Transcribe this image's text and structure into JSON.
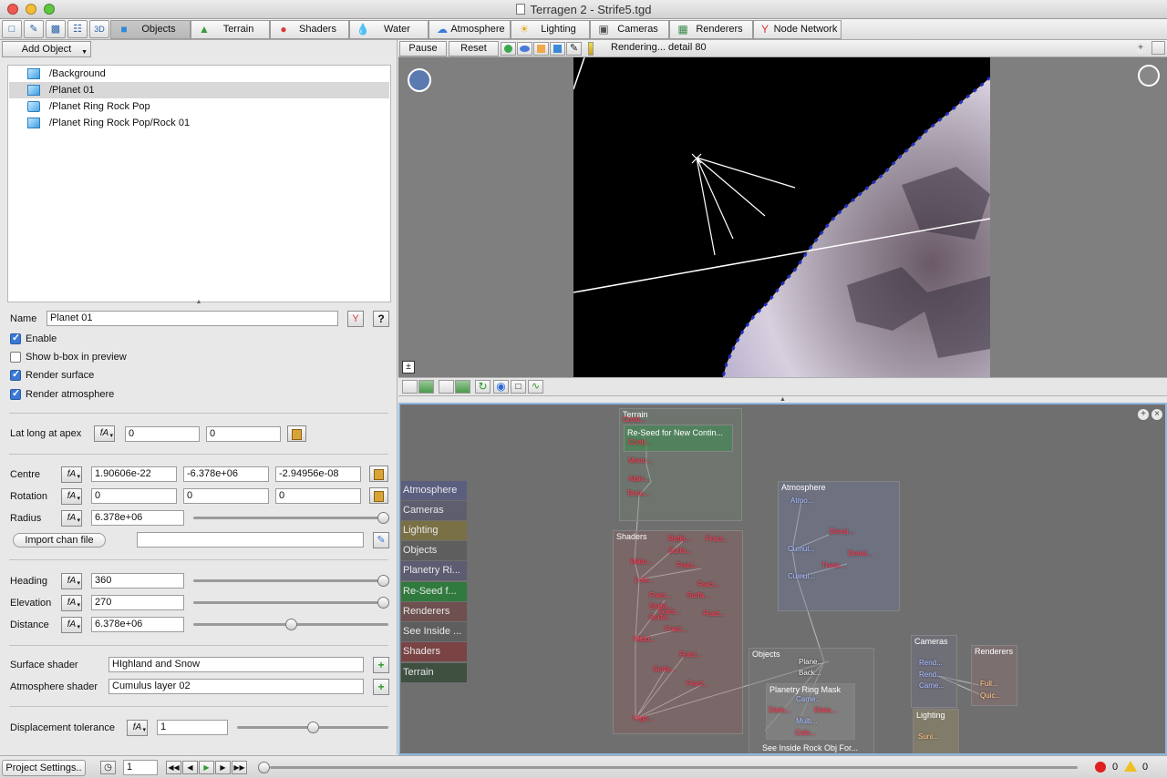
{
  "window": {
    "title": "Terragen 2 - Strife5.tgd"
  },
  "colors": {
    "selection": "#d8d8d8",
    "node_text_red": "#ff4060",
    "network_bg": "#6f6f6f",
    "active_tab": "#b8b8b8"
  },
  "toolbar": {
    "icons": [
      "new-file-icon",
      "open-file-icon",
      "save-file-icon",
      "render-settings-icon",
      "3d-preview-icon"
    ],
    "tabs": [
      {
        "label": "Objects",
        "icon": "cube-icon",
        "active": true
      },
      {
        "label": "Terrain",
        "icon": "terrain-icon"
      },
      {
        "label": "Shaders",
        "icon": "sphere-icon"
      },
      {
        "label": "Water",
        "icon": "water-drop-icon"
      },
      {
        "label": "Atmosphere",
        "icon": "sky-icon"
      },
      {
        "label": "Lighting",
        "icon": "sun-icon"
      },
      {
        "label": "Cameras",
        "icon": "camera-icon"
      },
      {
        "label": "Renderers",
        "icon": "render-icon"
      },
      {
        "label": "Node Network",
        "icon": "node-network-icon"
      }
    ]
  },
  "objects_panel": {
    "add_object_label": "Add Object",
    "items": [
      {
        "label": "/Background",
        "selected": false
      },
      {
        "label": "/Planet 01",
        "selected": true
      },
      {
        "label": "/Planet Ring Rock Pop",
        "selected": false
      },
      {
        "label": "/Planet Ring Rock Pop/Rock 01",
        "selected": false
      }
    ]
  },
  "properties": {
    "name_label": "Name",
    "name_value": "Planet 01",
    "help_label": "?",
    "checkboxes": [
      {
        "label": "Enable",
        "checked": true
      },
      {
        "label": "Show b-box in preview",
        "checked": false
      },
      {
        "label": "Render surface",
        "checked": true
      },
      {
        "label": "Render atmosphere",
        "checked": true
      }
    ],
    "latlong": {
      "label": "Lat long at apex",
      "values": [
        "0",
        "0"
      ]
    },
    "centre": {
      "label": "Centre",
      "values": [
        "1.90606e-22",
        "-6.378e+06",
        "-2.94956e-08"
      ]
    },
    "rotation": {
      "label": "Rotation",
      "values": [
        "0",
        "0",
        "0"
      ]
    },
    "radius": {
      "label": "Radius",
      "value": "6.378e+06",
      "slider_fraction": 1.0
    },
    "import_button": "Import chan file",
    "import_path": "",
    "heading": {
      "label": "Heading",
      "value": "360",
      "slider_fraction": 1.0
    },
    "elevation": {
      "label": "Elevation",
      "value": "270",
      "slider_fraction": 1.0
    },
    "distance": {
      "label": "Distance",
      "value": "6.378e+06",
      "slider_fraction": 0.5
    },
    "surface_shader": {
      "label": "Surface shader",
      "value": "HIghland and Snow"
    },
    "atmosphere_shader": {
      "label": "Atmosphere shader",
      "value": "Cumulus layer 02"
    },
    "displacement": {
      "label": "Displacement tolerance",
      "value": "1",
      "slider_fraction": 0.5
    },
    "fn_glyph": "fA"
  },
  "viewport": {
    "pause_label": "Pause",
    "reset_label": "Reset",
    "status": "Rendering... detail 80"
  },
  "network": {
    "side_tabs": [
      {
        "label": "Atmosphere",
        "color": "#5a5f80"
      },
      {
        "label": "Cameras",
        "color": "#5e5e6e"
      },
      {
        "label": "Lighting",
        "color": "#7a7046"
      },
      {
        "label": "Objects",
        "color": "#5e5e5e"
      },
      {
        "label": "Planetry Ri...",
        "color": "#5c5c72"
      },
      {
        "label": "Re-Seed f...",
        "color": "#2f7a3c"
      },
      {
        "label": "Renderers",
        "color": "#6e5050"
      },
      {
        "label": "See Inside ...",
        "color": "#5e5e5e"
      },
      {
        "label": "Shaders",
        "color": "#7a4444"
      },
      {
        "label": "Terrain",
        "color": "#3e5040"
      }
    ],
    "groups": {
      "terrain": "Terrain",
      "reseed": "Re-Seed for New Contin...",
      "shaders": "Shaders",
      "atmosphere": "Atmosphere",
      "objects": "Objects",
      "ring_mask": "Planetry Ring Mask",
      "see_inside": "See Inside Rock Obj For...",
      "cameras": "Cameras",
      "renderers": "Renderers",
      "lighting": "Lighting"
    },
    "nodes": {
      "terrain": [
        "Conti...",
        "Conti...",
        "Moun...",
        "Alpin...",
        "Textu..."
      ],
      "shaders": [
        "Refle...",
        "Fract...",
        "Surfa...",
        "Wate...",
        "Fract...",
        "Low...",
        "Fract...",
        "Fract...",
        "Surfa...",
        "Fract...",
        "Surfa...",
        "Fract...",
        "Surfa...",
        "Fract...",
        "Midd...",
        "Fract...",
        "Surfa...",
        "Fract...",
        "HIgh..."
      ],
      "atmosphere": [
        "Atmo...",
        "Densi...",
        "Cumul...",
        "Densi...",
        "Trans...",
        "Cumul..."
      ],
      "objects": [
        "Plane...",
        "Back..."
      ],
      "ring_mask": [
        "Came...",
        "Dista...",
        "Dista...",
        "Multi...",
        "Colo..."
      ],
      "cameras": [
        "Rend...",
        "Rend...",
        "Came..."
      ],
      "renderers": [
        "Full...",
        "Quic..."
      ],
      "lighting": [
        "Suni..."
      ]
    }
  },
  "bottom_bar": {
    "project_settings": "Project Settings..",
    "frame": "1",
    "errors": "0",
    "warnings": "0"
  }
}
